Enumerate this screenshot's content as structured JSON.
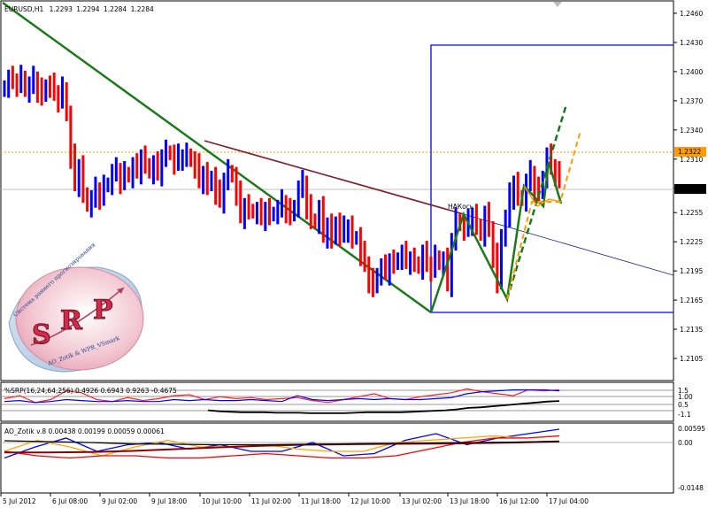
{
  "window": {
    "title": "EURUSD,H1",
    "ohlc": [
      "1.2293",
      "1.2294",
      "1.2284",
      "1.2284"
    ]
  },
  "colors": {
    "up_bar": "#0000ff",
    "down_bar": "#ff0000",
    "trend": "#1a7a1a",
    "maroon_line": "#7a1f2a",
    "navy_line": "#1a1a8c",
    "box": "#0000ff",
    "dashed_green": "#1a7a1a",
    "dashed_orange": "#ff9a00",
    "zigzag_orange": "#ff9a00"
  },
  "chart_data": [
    {
      "type": "candlestick",
      "panel": "main",
      "symbol": "EURUSD",
      "timeframe": "H1",
      "ylim": [
        1.2095,
        1.2465
      ],
      "y_ticks": [
        "1.2460",
        "1.2430",
        "1.2400",
        "1.2370",
        "1.2340",
        "1.2310",
        "1.2280",
        "1.2255",
        "1.2225",
        "1.2195",
        "1.2165",
        "1.2135",
        "1.2105"
      ],
      "price_markers": [
        {
          "value": "1.2322",
          "role": "level"
        },
        {
          "value": "1.2284",
          "role": "current"
        }
      ],
      "x_ticks": [
        "5 Jul 2012",
        "6 Jul 08:00",
        "9 Jul 02:00",
        "9 Jul 18:00",
        "10 Jul 10:00",
        "11 Jul 02:00",
        "11 Jul 18:00",
        "12 Jul 10:00",
        "13 Jul 02:00",
        "13 Jul 18:00",
        "16 Jul 12:00",
        "17 Jul 04:00"
      ],
      "bars_approx_close": [
        1.2385,
        1.2392,
        1.239,
        1.2388,
        1.2395,
        1.238,
        1.2385,
        1.2392,
        1.2382,
        1.2375,
        1.2386,
        1.2385,
        1.2378,
        1.2372,
        1.2383,
        1.2355,
        1.2312,
        1.2285,
        1.2302,
        1.2275,
        1.2262,
        1.2268,
        1.2278,
        1.2272,
        1.2282,
        1.2285,
        1.2295,
        1.2298,
        1.2288,
        1.2296,
        1.2292,
        1.2302,
        1.2298,
        1.2312,
        1.2305,
        1.2296,
        1.2304,
        1.2296,
        1.2312,
        1.2318,
        1.2315,
        1.2306,
        1.2312,
        1.2312,
        1.2315,
        1.2308,
        1.2302,
        1.2288,
        1.2295,
        1.2283,
        1.2292,
        1.2275,
        1.2268,
        1.2288,
        1.2298,
        1.2292,
        1.2274,
        1.2252,
        1.2262,
        1.2258,
        1.2255,
        1.2256,
        1.225,
        1.2258,
        1.2252,
        1.2255,
        1.2258,
        1.2265,
        1.2258,
        1.2252,
        1.2262,
        1.2278,
        1.2285,
        1.2262,
        1.2248,
        1.2245,
        1.2258,
        1.2232,
        1.2242,
        1.2228,
        1.2245,
        1.2232,
        1.2238,
        1.224,
        1.2228,
        1.223,
        1.2212,
        1.2202,
        1.2186,
        1.2178,
        1.2192,
        1.2198,
        1.2194,
        1.2205,
        1.2202,
        1.2208,
        1.2212,
        1.2205,
        1.2207,
        1.2204,
        1.2198,
        1.2212,
        1.2202,
        1.2198,
        1.221,
        1.2202,
        1.2205,
        1.2182,
        1.2226,
        1.2248,
        1.2242,
        1.2238,
        1.2245,
        1.2252,
        1.2242,
        1.2232,
        1.2252,
        1.2238,
        1.2212,
        1.2182,
        1.2232,
        1.2248,
        1.2272,
        1.2285,
        1.2272,
        1.2268,
        1.2285,
        1.2295,
        1.228,
        1.2275,
        1.2292,
        1.2312,
        1.2302,
        1.2296,
        1.229
      ],
      "annotations": [
        {
          "type": "trendline",
          "from": [
            "5 Jul",
            1.2462
          ],
          "to": [
            "13 Jul 02:00",
            1.2165
          ]
        },
        {
          "type": "trendline",
          "from": [
            "10 Jul 08:00",
            1.2333
          ],
          "to": [
            "13 Jul 18:00",
            1.2258
          ]
        },
        {
          "type": "trendline",
          "from": [
            "13 Jul 18:00",
            1.2258
          ],
          "to": [
            "17 Jul 12:00",
            1.2195
          ]
        },
        {
          "type": "rectangle",
          "high": 1.243,
          "low": 1.2165,
          "from": "13 Jul 02:00"
        },
        {
          "type": "label",
          "text": "НАКось"
        }
      ]
    },
    {
      "type": "line",
      "panel": "indicator-1",
      "title": "%SRP(16,24,64,256) 0.4926 0.6943 0.9263 -0.4675",
      "y_ticks": [
        "1.5",
        "1.00",
        "0.5",
        "-1.1"
      ],
      "series": [
        {
          "color": "#ff2020",
          "values": [
            0.6,
            0.9,
            0.2,
            0.5,
            1.4,
            1.2,
            0.5,
            0.3,
            0.7,
            0.4,
            0.6,
            0.9,
            1.0,
            0.5,
            0.8,
            0.6,
            0.7,
            0.5,
            0.6,
            0.7,
            0.4,
            0.2,
            0.5,
            0.8,
            1.1,
            0.6,
            0.5,
            0.8,
            1.0,
            1.2,
            1.6,
            1.3,
            1.1,
            0.9,
            1.5,
            1.4,
            1.5
          ]
        },
        {
          "color": "#0000ff",
          "values": [
            0.3,
            0.4,
            0.2,
            0.3,
            0.5,
            0.4,
            0.3,
            0.3,
            0.4,
            0.3,
            0.3,
            0.5,
            0.4,
            0.5,
            0.4,
            0.4,
            0.5,
            0.4,
            0.3,
            0.9,
            0.5,
            0.4,
            0.5,
            0.6,
            0.5,
            0.6,
            0.5,
            0.5,
            0.6,
            0.7,
            1.1,
            1.3,
            1.4,
            1.5,
            1.5,
            1.5,
            1.4
          ]
        },
        {
          "color": "#000000",
          "values": [
            -0.6,
            -0.7,
            -0.75,
            -0.8,
            -0.8,
            -0.8,
            -0.85,
            -0.85,
            -0.85,
            -0.9,
            -0.9,
            -0.9,
            -0.9,
            -0.85,
            -0.8,
            -0.8,
            -0.8,
            -0.8,
            -0.75,
            -0.7,
            -0.65,
            -0.6,
            -0.5,
            -0.35,
            -0.3,
            -0.2,
            -0.1,
            0.0,
            0.1,
            0.2,
            0.3,
            0.35
          ]
        }
      ]
    },
    {
      "type": "line",
      "panel": "indicator-2",
      "title": "AO_Zotik v.8 0.00438 0.00199 0.00059 0.00061",
      "y_ticks": [
        "0.00595",
        "0.00",
        "-0.0148"
      ],
      "series": [
        {
          "color": "#0000ff",
          "values": [
            -0.007,
            -0.002,
            0.002,
            -0.004,
            -0.001,
            0.0,
            -0.003,
            -0.001,
            -0.004,
            -0.004,
            0.0,
            -0.006,
            -0.005,
            0.001,
            0.004,
            -0.001,
            0.002,
            0.004,
            0.006
          ]
        },
        {
          "color": "#ffa500",
          "values": [
            -0.004,
            0.001,
            -0.002,
            -0.006,
            -0.002,
            0.001,
            -0.002,
            -0.002,
            -0.001,
            -0.003,
            -0.004,
            -0.004,
            0.0,
            0.001,
            0.002,
            0.003,
            0.002,
            0.003
          ]
        },
        {
          "color": "#ff0000",
          "values": [
            -0.004,
            -0.006,
            -0.007,
            -0.006,
            -0.006,
            -0.007,
            -0.007,
            -0.006,
            -0.005,
            -0.006,
            -0.007,
            -0.007,
            -0.006,
            -0.003,
            0.0,
            0.002,
            0.002,
            0.003
          ]
        },
        {
          "color": "#8b0000",
          "values": [
            -0.0045,
            -0.0045,
            -0.0043,
            -0.0038,
            -0.003,
            -0.0022,
            -0.0015,
            -0.001,
            -0.0008,
            -0.0006,
            -0.0005,
            -0.0003,
            0.0,
            0.0005
          ]
        },
        {
          "color": "#000000",
          "values": [
            0.0008,
            0.0004,
            0.0,
            -0.0006,
            -0.0008,
            -0.001,
            -0.001,
            -0.0008,
            -0.0006,
            -0.0004,
            -0.0002,
            0.0,
            0.0002,
            0.0005
          ]
        }
      ]
    }
  ],
  "logo": {
    "letters": "SRP",
    "arc_top": "Система раннего прогнозирования",
    "arc_bottom": "AO_Zotik & WPR_VSmark"
  }
}
